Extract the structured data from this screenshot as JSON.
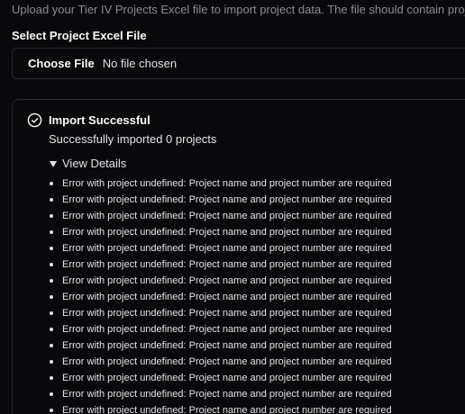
{
  "description": "Upload your Tier IV Projects Excel file to import project data. The file should contain project",
  "file_field": {
    "label": "Select Project Excel File",
    "button_label": "Choose File",
    "status_text": "No file chosen"
  },
  "result": {
    "icon": "check-circle-icon",
    "title": "Import Successful",
    "message": "Successfully imported 0 projects",
    "details_label": "View Details",
    "errors": [
      "Error with project undefined: Project name and project number are required",
      "Error with project undefined: Project name and project number are required",
      "Error with project undefined: Project name and project number are required",
      "Error with project undefined: Project name and project number are required",
      "Error with project undefined: Project name and project number are required",
      "Error with project undefined: Project name and project number are required",
      "Error with project undefined: Project name and project number are required",
      "Error with project undefined: Project name and project number are required",
      "Error with project undefined: Project name and project number are required",
      "Error with project undefined: Project name and project number are required",
      "Error with project undefined: Project name and project number are required",
      "Error with project undefined: Project name and project number are required",
      "Error with project undefined: Project name and project number are required",
      "Error with project undefined: Project name and project number are required",
      "Error with project undefined: Project name and project number are required"
    ]
  }
}
